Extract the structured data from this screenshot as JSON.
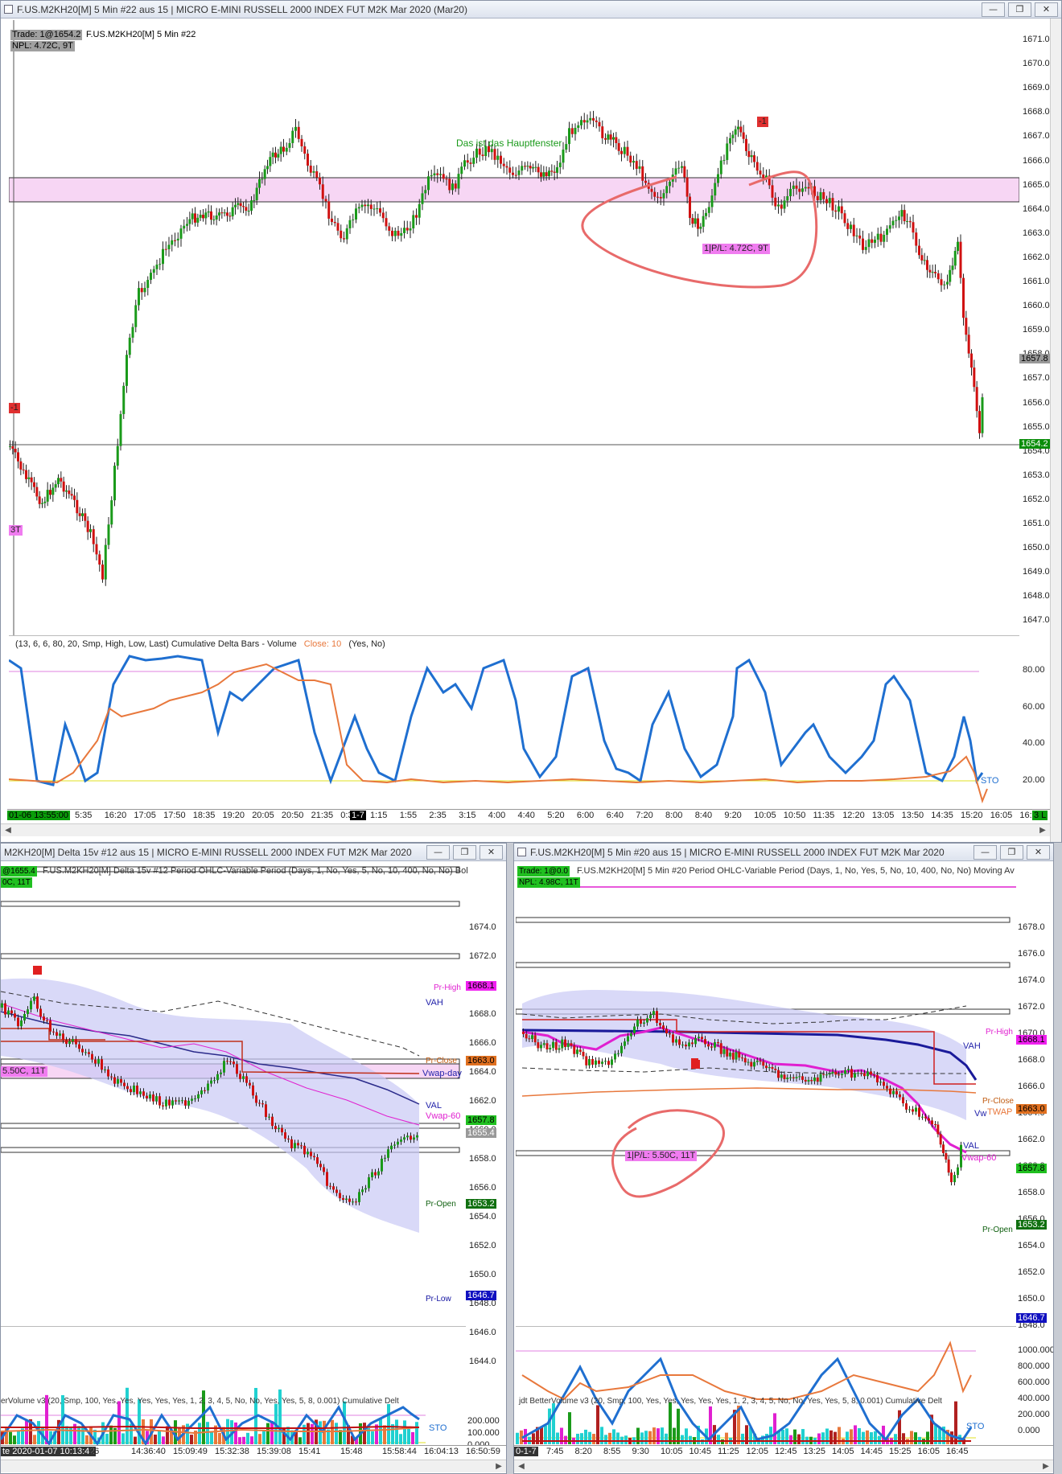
{
  "main": {
    "title": "F.US.M2KH20[M]  5 Min   #22  aus 15 | MICRO E-MINI RUSSELL 2000 INDEX FUT M2K Mar 2020 (Mar20)",
    "trade_label": "Trade: 1@1654.2",
    "symbol_label": "F.US.M2KH20[M]  5 Min   #22",
    "npl_label": "NPL: 4.72C, 9T",
    "annotation": "Das ist das Hauptfenster",
    "pl_tag": "1|P/L: 4.72C, 9T",
    "minus_one": "-1",
    "left_tag_top": "-1",
    "left_tag_bottom": "3T",
    "price_labels": [
      "1671.0",
      "1670.0",
      "1669.0",
      "1668.0",
      "1667.0",
      "1666.0",
      "1665.0",
      "1664.0",
      "1663.0",
      "1662.0",
      "1661.0",
      "1660.0",
      "1659.0",
      "1658.0",
      "1657.0",
      "1656.0",
      "1655.0",
      "1654.0",
      "1653.0",
      "1652.0",
      "1651.0",
      "1650.0",
      "1649.0",
      "1648.0",
      "1647.0"
    ],
    "last_price": "1657.8",
    "position_price": "1654.2",
    "indicator_header": "(13, 6, 6, 80, 20, Smp, High, Low, Last)  Cumulative Delta Bars - Volume",
    "indicator_close": "Close: 10",
    "indicator_tail": "(Yes, No)",
    "osc_labels": [
      "80.00",
      "60.00",
      "40.00",
      "20.00"
    ],
    "sto_label": "STO",
    "date_label": "01-06  13:55:00",
    "session_label": "1-7",
    "time_labels": [
      "5:35",
      "16:20",
      "17:05",
      "17:50",
      "18:35",
      "19:20",
      "20:05",
      "20:50",
      "21:35",
      "0:35",
      "1:15",
      "1:55",
      "2:35",
      "3:15",
      "4:00",
      "4:40",
      "5:20",
      "6:00",
      "6:40",
      "7:20",
      "8:00",
      "8:40",
      "9:20",
      "10:05",
      "10:50",
      "11:35",
      "12:20",
      "13:05",
      "13:50",
      "14:35",
      "15:20",
      "16:05",
      "16:50"
    ],
    "corner_tag": "3 L"
  },
  "left": {
    "title": "M2KH20[M]  Delta 15v  #12  aus 15 | MICRO E-MINI RUSSELL 2000 INDEX FUT M2K Mar 2020",
    "header": "F.US.M2KH20[M]  Delta 15v  #12 Period OHLC-Variable Period   (Days, 1, No, Yes, 5, No, 10, 400, No, No)  Bol",
    "price_labels": [
      "1674.0",
      "1672.0",
      "1670.0",
      "1668.0",
      "1666.0",
      "1664.0",
      "1662.0",
      "1660.0",
      "1658.0",
      "1656.0",
      "1654.0",
      "1652.0",
      "1650.0",
      "1648.0",
      "1646.0",
      "1644.0"
    ],
    "pr_high": "Pr-High",
    "pr_high_val": "1668.1",
    "vah": "VAH",
    "pr_close": "Pr-Close",
    "pr_close_val": "1663.0",
    "vwap_day": "Vwap-day",
    "val": "VAL",
    "vwap60": "Vwap-60",
    "last_val": "1657.8",
    "pos_val": "1655.4",
    "pr_open": "Pr-Open",
    "pr_open_val": "1653.2",
    "pr_low": "Pr-Low",
    "pr_low_val": "1646.7",
    "pl_tag": "5.50C, 11T",
    "vol_header": "erVolume v3   (20, Smp, 100, Yes, Yes, Yes, Yes, Yes, 1, 2, 3, 4, 5, No, No, Yes, Yes, 5, 8, 0.001)  Cumulative Delt",
    "vol_labels": [
      "200.000",
      "100.000",
      "0.000"
    ],
    "sto": "STO",
    "date_label": "te 2020-01-07  10:13:42",
    "time_labels": [
      "26",
      "14:36:40",
      "15:09:49",
      "15:32:38",
      "15:39:08",
      "15:41",
      "15:48",
      "15:58:44",
      "16:04:13",
      "16:50:59"
    ]
  },
  "right": {
    "title": "F.US.M2KH20[M]  5 Min   #20  aus 15 | MICRO E-MINI RUSSELL 2000 INDEX FUT M2K Mar 2020",
    "header": "F.US.M2KH20[M]  5 Min   #20 Period OHLC-Variable Period   (Days, 1, No, Yes, 5, No, 10, 400, No, No)  Moving Av",
    "trade_label": "Trade: 1@0.0",
    "npl_label": "NPL: 4.98C, 11T",
    "price_labels": [
      "1678.0",
      "1676.0",
      "1674.0",
      "1672.0",
      "1670.0",
      "1668.0",
      "1666.0",
      "1664.0",
      "1662.0",
      "1660.0",
      "1658.0",
      "1656.0",
      "1654.0",
      "1652.0",
      "1650.0",
      "1648.0"
    ],
    "pr_high": "Pr-High",
    "pr_high_val": "1668.1",
    "vah": "VAH",
    "pr_close": "Pr-Close",
    "pr_close_val": "1663.0",
    "vwap_partial": "Vw",
    "twap": "TWAP",
    "val": "VAL",
    "vwap60": "Vwap-60",
    "last_val": "1657.8",
    "pr_open": "Pr-Open",
    "pr_open_val": "1653.2",
    "pr_low_val": "1646.7",
    "pl_tag": "1|P/L: 5.50C, 11T",
    "vol_header": "jdt BetterVolume v3   (20, Smp, 100, Yes, Yes, Yes, Yes, Yes, 1, 2, 3, 4, 5, No, No, Yes, Yes, 5, 8, 0.001)  Cumulative Delt",
    "vol_labels": [
      "1000.000",
      "800.000",
      "600.000",
      "400.000",
      "200.000",
      "0.000"
    ],
    "sto": "STO",
    "date_label": "0-1-7",
    "time_labels": [
      "7:45",
      "8:20",
      "8:55",
      "9:30",
      "10:05",
      "10:45",
      "11:25",
      "12:05",
      "12:45",
      "13:25",
      "14:05",
      "14:45",
      "15:25",
      "16:05",
      "16:45"
    ]
  },
  "colors": {
    "zone": "#f7d6f4",
    "bull": "#1a9a1a",
    "bear": "#d01010",
    "osc": "#1f6fd0",
    "delta": "#e8783c",
    "vwap60": "#e020d0",
    "highlight_circle": "#e86a6a"
  }
}
